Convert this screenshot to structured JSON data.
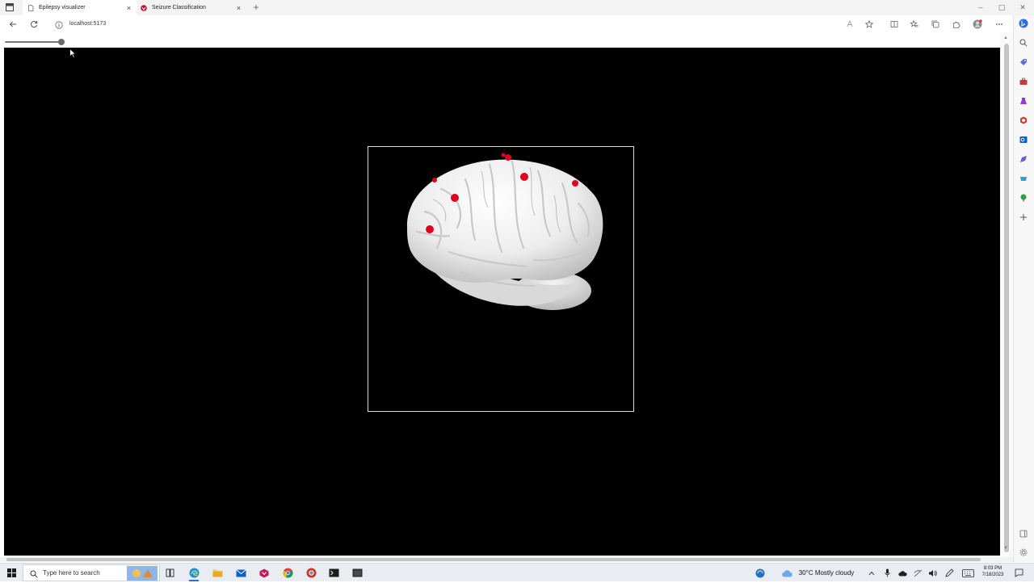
{
  "browser": {
    "tabs": [
      {
        "title": "Epilepsy visualizer",
        "active": true
      },
      {
        "title": "Seizure Classification",
        "active": false
      }
    ],
    "address": {
      "url": "localhost:5173"
    }
  },
  "page": {
    "background": "#000000",
    "view_slider": {
      "value": 1.0
    },
    "brain": {
      "electrode_color": "#e0001b",
      "electrode_count": 7
    }
  },
  "taskbar": {
    "search_placeholder": "Type here to search",
    "weather": "30°C  Mostly cloudy",
    "time": "8:03 PM",
    "date": "7/18/2023"
  }
}
